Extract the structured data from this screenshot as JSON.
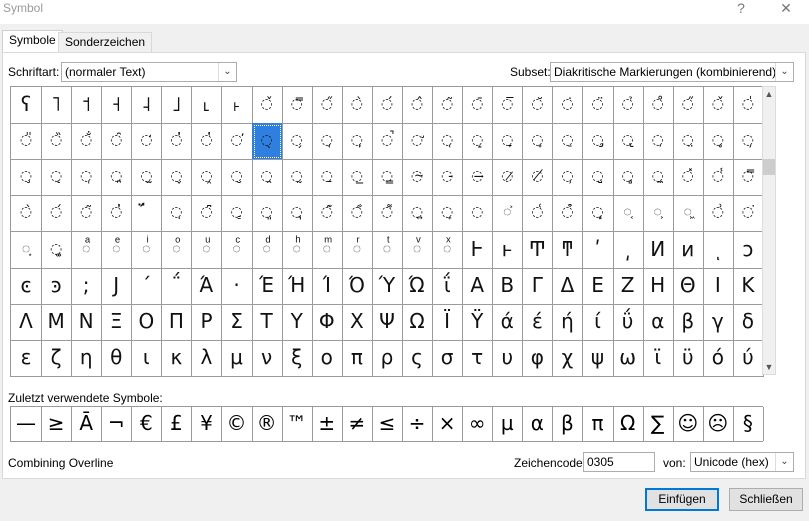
{
  "window": {
    "title": "Symbol",
    "help": "?",
    "close": "✕"
  },
  "tabs": [
    {
      "label": "Symbole"
    },
    {
      "label": "Sonderzeichen"
    }
  ],
  "font": {
    "label": "Schriftart:",
    "value": "(normaler Text)"
  },
  "subset": {
    "label": "Subset:",
    "value": "Diakritische Markierungen (kombinierend)"
  },
  "grid": {
    "rows": [
      [
        "ʕ",
        "˥",
        "˦",
        "˧",
        "˨",
        "˩",
        "˪",
        "˫",
        "̌",
        "̿",
        "̋",
        "̀",
        "́",
        "̂",
        "̃",
        "̄",
        "̅",
        "̆",
        "̇",
        "̈",
        "̉",
        "̊",
        "̋",
        "̌",
        "̍"
      ],
      [
        "̎",
        "̏",
        "̐",
        "̑",
        "̒",
        "̓",
        "̔",
        "̕",
        "̖",
        "̗",
        "̘",
        "̙",
        "̚",
        "̛",
        "̜",
        "̝",
        "̞",
        "̟",
        "̠",
        "̡",
        "̢",
        "̣",
        "̤",
        "̥",
        "̦"
      ],
      [
        "̧",
        "̨",
        "̩",
        "̪",
        "̫",
        "̬",
        "̭",
        "̮",
        "̯",
        "̰",
        "̱",
        "̲",
        "̳",
        "̴",
        "̵",
        "̶",
        "̷",
        "̸",
        "̹",
        "̺",
        "̻",
        "̼",
        "̽",
        "̾",
        "̿"
      ],
      [
        "̀",
        "́",
        "͂",
        "̓",
        "̈́",
        "ͅ",
        "͆",
        "͇",
        "͈",
        "͉",
        "͊",
        "͋",
        "͌",
        "͍",
        "͎",
        "͏",
        "͐",
        "͑",
        "͒",
        "͓",
        "͔",
        "͕",
        "͖",
        "͗",
        "͘"
      ],
      [
        "͙",
        "͚",
        "ͣ",
        "ͤ",
        "ͥ",
        "ͦ",
        "ͧ",
        "ͨ",
        "ͩ",
        "ͪ",
        "ͫ",
        "ͬ",
        "ͭ",
        "ͮ",
        "ͯ",
        "Ͱ",
        "ͱ",
        "Ͳ",
        "ͳ",
        "ʹ",
        "͵",
        "Ͷ",
        "ͷ",
        "ͺ",
        "ͻ"
      ],
      [
        "ͼ",
        "ͽ",
        ";",
        "Ϳ",
        "΄",
        "΅",
        "Ά",
        "·",
        "Έ",
        "Ή",
        "Ί",
        "Ό",
        "Ύ",
        "Ώ",
        "ΐ",
        "Α",
        "Β",
        "Γ",
        "Δ",
        "Ε",
        "Ζ",
        "Η",
        "Θ",
        "Ι",
        "Κ"
      ],
      [
        "Λ",
        "Μ",
        "Ν",
        "Ξ",
        "Ο",
        "Π",
        "Ρ",
        "Σ",
        "Τ",
        "Υ",
        "Φ",
        "Χ",
        "Ψ",
        "Ω",
        "Ϊ",
        "Ϋ",
        "ά",
        "έ",
        "ή",
        "ί",
        "ΰ",
        "α",
        "β",
        "γ",
        "δ"
      ],
      [
        "ε",
        "ζ",
        "η",
        "θ",
        "ι",
        "κ",
        "λ",
        "μ",
        "ν",
        "ξ",
        "ο",
        "π",
        "ρ",
        "ς",
        "σ",
        "τ",
        "υ",
        "φ",
        "χ",
        "ψ",
        "ω",
        "ϊ",
        "ϋ",
        "ό",
        "ύ"
      ]
    ],
    "selected": {
      "row": 1,
      "col": 8
    }
  },
  "recent": {
    "label": "Zuletzt verwendete Symbole:",
    "items": [
      "—",
      "≥",
      "Ā",
      "¬",
      "€",
      "£",
      "¥",
      "©",
      "®",
      "™",
      "±",
      "≠",
      "≤",
      "÷",
      "×",
      "∞",
      "µ",
      "α",
      "β",
      "π",
      "Ω",
      "∑",
      "☺",
      "☹",
      "§"
    ]
  },
  "char_name": "Combining Overline",
  "code": {
    "label": "Zeichencode:",
    "value": "0305"
  },
  "from": {
    "label": "von:",
    "value": "Unicode (hex)"
  },
  "buttons": {
    "insert": "Einfügen",
    "close": "Schließen"
  }
}
